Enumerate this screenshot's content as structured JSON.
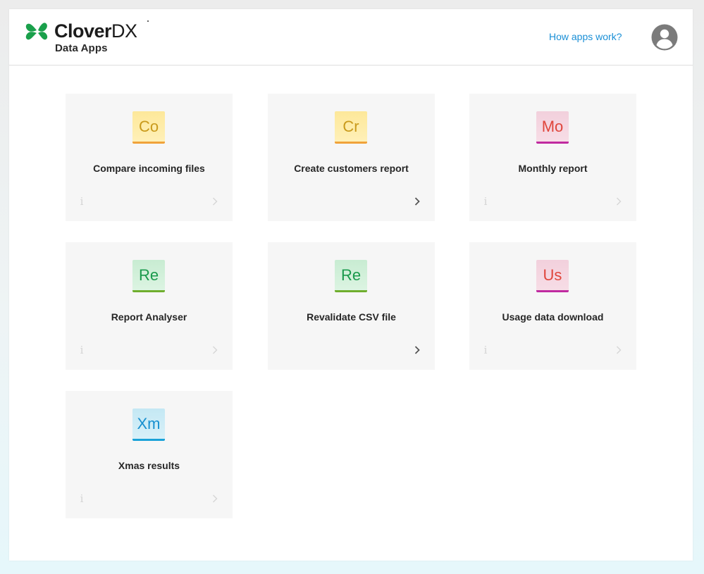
{
  "header": {
    "brand_name_bold": "Clover",
    "brand_name_light": "DX",
    "brand_subtitle": "Data Apps",
    "help_link": "How apps work?",
    "user_icon": "user-account-icon"
  },
  "colors": {
    "brand_green": "#1aa04b",
    "link_blue": "#1a8fd6",
    "card_bg": "#f6f6f6"
  },
  "apps": [
    {
      "abbr": "Co",
      "title": "Compare incoming files",
      "theme": "yellow",
      "info_visible": true
    },
    {
      "abbr": "Cr",
      "title": "Create customers report",
      "theme": "yellow",
      "info_visible": false
    },
    {
      "abbr": "Mo",
      "title": "Monthly report",
      "theme": "pink",
      "info_visible": true
    },
    {
      "abbr": "Re",
      "title": "Report Analyser",
      "theme": "green",
      "info_visible": true
    },
    {
      "abbr": "Re",
      "title": "Revalidate CSV file",
      "theme": "green",
      "info_visible": false
    },
    {
      "abbr": "Us",
      "title": "Usage data download",
      "theme": "pink",
      "info_visible": true
    },
    {
      "abbr": "Xm",
      "title": "Xmas results",
      "theme": "blue",
      "info_visible": true
    }
  ],
  "themes": {
    "yellow": {
      "bg": "#fde89a",
      "bg2": "#fff0b8",
      "text": "#c99a1c",
      "bar": "#f0a23a"
    },
    "pink": {
      "bg": "#f2d0dc",
      "bg2": "#f7dde6",
      "text": "#e0463c",
      "bar": "#c02ba0"
    },
    "green": {
      "bg": "#c8ecd2",
      "bg2": "#dcf4e2",
      "text": "#1a9a4c",
      "bar": "#6fae2e"
    },
    "blue": {
      "bg": "#c4e8f4",
      "bg2": "#d8f0f8",
      "text": "#1790d0",
      "bar": "#1aa2d8"
    }
  }
}
